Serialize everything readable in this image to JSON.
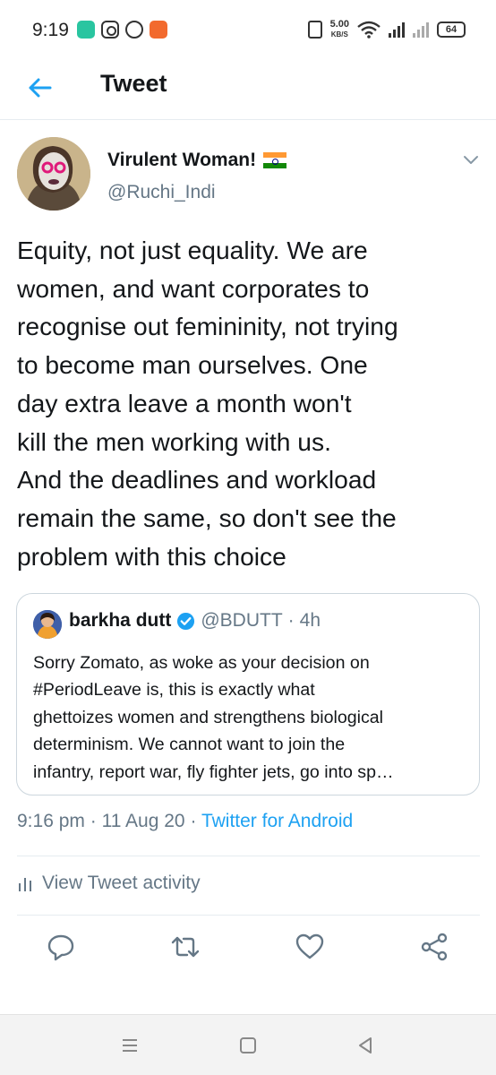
{
  "status_bar": {
    "time": "9:19",
    "speed": "5.00",
    "speed_unit": "KB/S",
    "battery": "64",
    "icons": [
      "app-icon",
      "instagram-icon",
      "whatsapp-icon",
      "notification-icon",
      "vibrate-icon",
      "wifi-icon",
      "signal-icon",
      "signal-icon-2",
      "battery-icon"
    ]
  },
  "header": {
    "title": "Tweet",
    "back_icon": "back-arrow-icon"
  },
  "tweet": {
    "author_name": "Virulent Woman!",
    "author_handle": "@Ruchi_Indi",
    "text_lines": [
      "Equity, not just equality. We are",
      "women, and want corporates to",
      "recognise out femininity, not trying",
      "to become man ourselves. One",
      "day extra leave a month won't",
      "kill the men working with us.",
      "And the deadlines and workload",
      "remain the same, so don't see the",
      "problem with this choice"
    ],
    "quoted": {
      "name": "barkha dutt",
      "handle": "@BDUTT",
      "time": "4h",
      "text_lines": [
        "Sorry Zomato, as woke as your decision on",
        "#PeriodLeave is, this is exactly what",
        "ghettoizes women and strengthens biological",
        "determinism. We cannot want to join the",
        "infantry, report war, fly fighter jets, go into sp…"
      ]
    },
    "time": "9:16 pm",
    "date": "11 Aug 20",
    "source": "Twitter for Android",
    "separator": "·"
  },
  "activity": {
    "label": "View Tweet activity"
  },
  "actions": [
    "reply-icon",
    "retweet-icon",
    "like-icon",
    "share-icon"
  ],
  "colors": {
    "accent": "#1da1f2",
    "secondary_text": "#657786",
    "primary_text": "#14171a",
    "border": "#ccd6dd"
  }
}
